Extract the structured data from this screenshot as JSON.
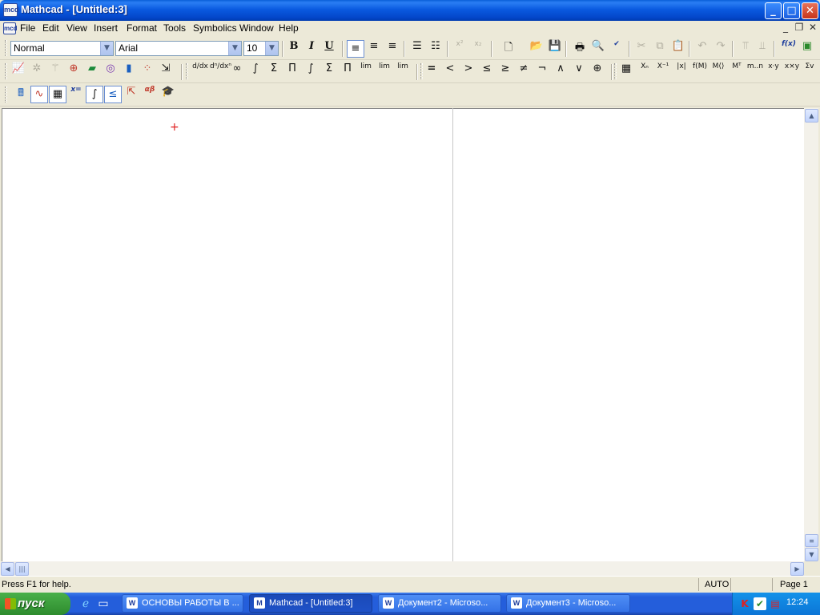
{
  "window": {
    "title": "Mathcad - [Untitled:3]",
    "icon_label": "mcd",
    "buttons": {
      "minimize": "_",
      "maximize": "□",
      "close": "✕"
    }
  },
  "menubar": {
    "items": [
      "File",
      "Edit",
      "View",
      "Insert",
      "Format",
      "Tools",
      "Symbolics",
      "Window",
      "Help"
    ],
    "mdi_buttons": {
      "minimize": "_",
      "restore": "❐",
      "close": "✕"
    }
  },
  "formatting_toolbar": {
    "style": "Normal",
    "font": "Arial",
    "size": "10",
    "bold": "B",
    "italic": "I",
    "underline": "U",
    "superscript": "x²",
    "subscript": "x₂",
    "function_button": "f(x)"
  },
  "math_toolbar": {
    "derivative": "d/dx",
    "nth_derivative": "dⁿ/dxⁿ",
    "infinity": "∞",
    "definite_integral": "∫",
    "summation": "Σ",
    "product": "Π",
    "indefinite_integral": "∫",
    "range_sum": "Σ",
    "range_product": "Π",
    "limit": "lim",
    "limit_right": "lim",
    "limit_left": "lim",
    "equal": "=",
    "less": "<",
    "greater": ">",
    "less_equal": "≤",
    "greater_equal": "≥",
    "not_equal": "≠",
    "not": "¬",
    "and": "∧",
    "or": "∨",
    "xor": "⊕",
    "matrix": "▦",
    "subscript": "Xₙ",
    "inverse": "X⁻¹",
    "determinant": "|x|",
    "vectorize": "f(M)",
    "column": "M⟨⟩",
    "transpose": "Mᵀ",
    "range": "m..n",
    "dot_product": "x·y",
    "cross_product": "x×y",
    "vector_sum": "Σv",
    "evaluate": "x=",
    "greek": "αβ"
  },
  "statusbar": {
    "help": "Press F1 for help.",
    "mode": "AUTO",
    "page": "Page 1"
  },
  "taskbar": {
    "start_label": "пуск",
    "tasks": [
      {
        "label": "ОСНОВЫ РАБОТЫ В ...",
        "icon": "W"
      },
      {
        "label": "Mathcad - [Untitled:3]",
        "icon": "M"
      },
      {
        "label": "Документ2 - Microso...",
        "icon": "W"
      },
      {
        "label": "Документ3 - Microso...",
        "icon": "W"
      }
    ],
    "clock": "12:24",
    "tray_kaspersky": "K"
  }
}
